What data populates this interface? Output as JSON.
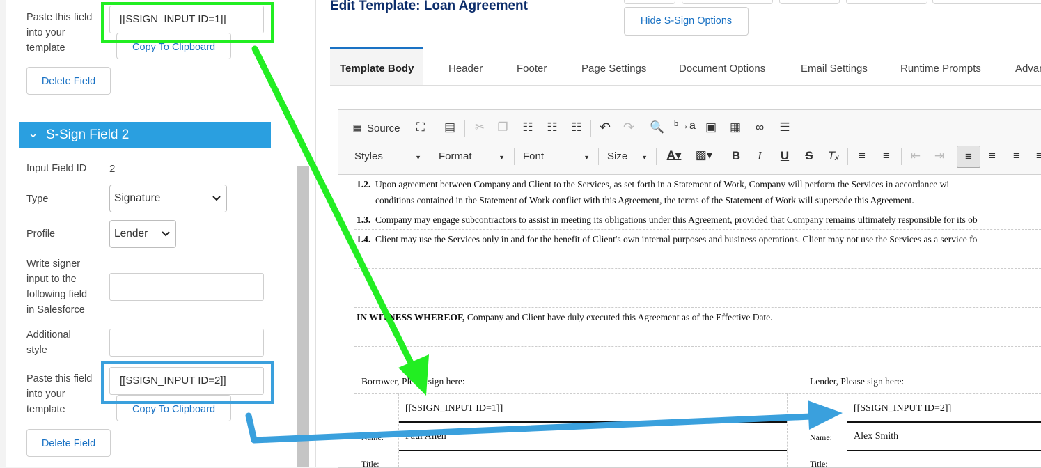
{
  "left": {
    "field1": {
      "paste_label_1": "Paste this field",
      "paste_label_2": "into your",
      "paste_label_3": "template",
      "paste_value": "[[SSIGN_INPUT ID=1]]",
      "copy_label": "Copy To Clipboard",
      "delete_label": "Delete Field"
    },
    "field2": {
      "section_title": "S-Sign Field 2",
      "input_id_label": "Input Field ID",
      "input_id_value": "2",
      "type_label": "Type",
      "type_value": "Signature",
      "profile_label": "Profile",
      "profile_value": "Lender",
      "write_label_1": "Write signer",
      "write_label_2": "input to the",
      "write_label_3": "following field",
      "write_label_4": "in Salesforce",
      "write_value": "",
      "style_label_1": "Additional",
      "style_label_2": "style",
      "style_value": "",
      "paste_label_1": "Paste this field",
      "paste_label_2": "into your",
      "paste_label_3": "template",
      "paste_value": "[[SSIGN_INPUT ID=2]]",
      "copy_label": "Copy To Clipboard",
      "delete_label": "Delete Field"
    }
  },
  "header": {
    "title": "Edit Template: Loan Agreement",
    "hide_label": "Hide S-Sign Options"
  },
  "tabs": [
    "Template Body",
    "Header",
    "Footer",
    "Page Settings",
    "Document Options",
    "Email Settings",
    "Runtime Prompts",
    "Advan"
  ],
  "toolbar": {
    "source": "Source",
    "styles": "Styles",
    "format": "Format",
    "font": "Font",
    "size": "Size"
  },
  "doc": {
    "c12_num": "1.2.",
    "c12_a": "Upon agreement between Company and Client to the Services, as set forth in a Statement of Work, Company will perform the Services in accordance wi",
    "c12_b": "conditions contained in the Statement of Work conflict with this Agreement, the terms of the Statement of Work will supersede this Agreement.",
    "c13_num": "1.3.",
    "c13": "Company may engage subcontractors to assist in meeting its obligations under this Agreement, provided that Company remains ultimately responsible for its ob",
    "c14_num": "1.4.",
    "c14": "Client may use the Services only in and for the benefit of Client's own internal purposes and business operations. Client may not use the Services as a service fo",
    "witness_bold": "IN WITNESS WHEREOF,",
    "witness_rest": " Company and Client have duly executed this Agreement as of the Effective Date.",
    "borrower_label": "Borrower, Please sign here:",
    "lender_label": "Lender, Please sign here:",
    "borrower_sig": "[[SSIGN_INPUT ID=1]]",
    "lender_sig": "[[SSIGN_INPUT ID=2]]",
    "name_label": "Name:",
    "borrower_name": "Paul Allen",
    "lender_name": "Alex Smith",
    "title_label": "Title:"
  },
  "colors": {
    "section_header": "#2a9fe0",
    "link": "#1a72c4",
    "title": "#0c2d6b",
    "highlight_green": "#22ee22",
    "highlight_blue": "#3aa0dd"
  }
}
